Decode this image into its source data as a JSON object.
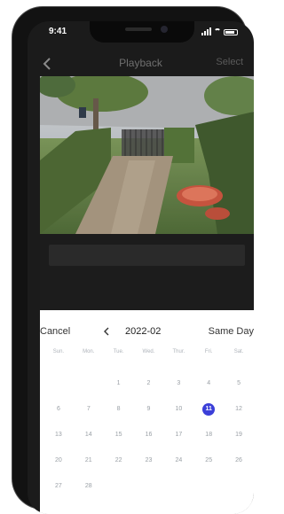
{
  "status": {
    "time": "9:41"
  },
  "nav": {
    "title": "Playback",
    "select_label": "Select"
  },
  "picker": {
    "cancel_label": "Cancel",
    "month": "2022-02",
    "same_day_label": "Same Day",
    "weekdays": [
      "Sun.",
      "Mon.",
      "Tue.",
      "Wed.",
      "Thur.",
      "Fri.",
      "Sat."
    ],
    "leading_blanks": 2,
    "days": [
      "1",
      "2",
      "3",
      "4",
      "5",
      "6",
      "7",
      "8",
      "9",
      "10",
      "11",
      "12",
      "13",
      "14",
      "15",
      "16",
      "17",
      "18",
      "19",
      "20",
      "21",
      "22",
      "23",
      "24",
      "25",
      "26",
      "27",
      "28"
    ],
    "selected_day": "11",
    "accent_color": "#3b3fd8"
  },
  "icons": {
    "back": "chevron-left-icon",
    "prev_month": "chevron-left-icon"
  }
}
